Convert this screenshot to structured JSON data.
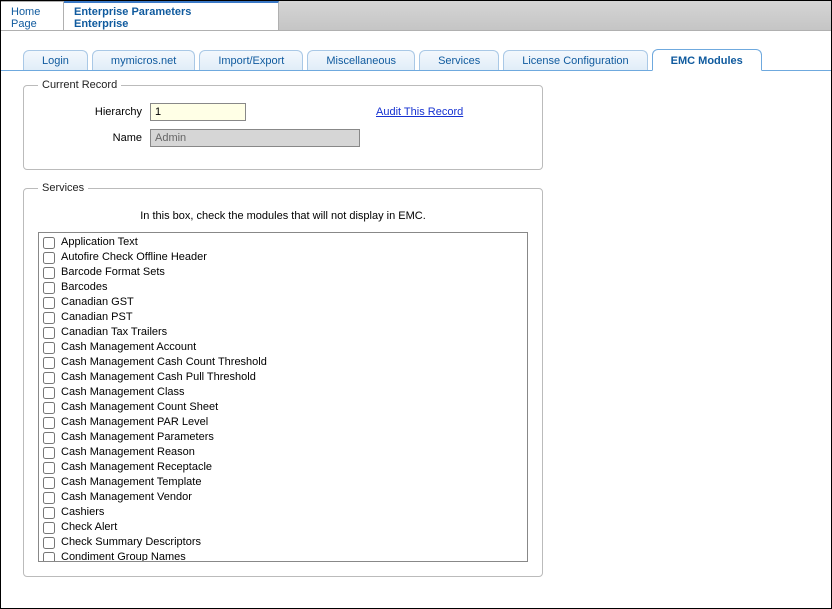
{
  "topbar": {
    "home": {
      "line1": "Home",
      "line2": "Page"
    },
    "enterprise": {
      "line1": "Enterprise Parameters",
      "line2": "Enterprise"
    }
  },
  "tabs": [
    {
      "label": "Login"
    },
    {
      "label": "mymicros.net"
    },
    {
      "label": "Import/Export"
    },
    {
      "label": "Miscellaneous"
    },
    {
      "label": "Services"
    },
    {
      "label": "License Configuration"
    },
    {
      "label": "EMC Modules"
    }
  ],
  "current_record": {
    "legend": "Current Record",
    "hierarchy_label": "Hierarchy",
    "hierarchy_value": "1",
    "name_label": "Name",
    "name_value": "Admin",
    "audit_link": "Audit This Record"
  },
  "services": {
    "legend": "Services",
    "instruction": "In this box, check the modules that will not display in EMC.",
    "modules": [
      {
        "label": "Application Text",
        "checked": false
      },
      {
        "label": "Autofire Check Offline Header",
        "checked": false
      },
      {
        "label": "Barcode Format Sets",
        "checked": false
      },
      {
        "label": "Barcodes",
        "checked": false
      },
      {
        "label": "Canadian GST",
        "checked": false
      },
      {
        "label": "Canadian PST",
        "checked": false
      },
      {
        "label": "Canadian Tax Trailers",
        "checked": false
      },
      {
        "label": "Cash Management Account",
        "checked": false
      },
      {
        "label": "Cash Management Cash Count Threshold",
        "checked": false
      },
      {
        "label": "Cash Management Cash Pull Threshold",
        "checked": false
      },
      {
        "label": "Cash Management Class",
        "checked": false
      },
      {
        "label": "Cash Management Count Sheet",
        "checked": false
      },
      {
        "label": "Cash Management PAR Level",
        "checked": false
      },
      {
        "label": "Cash Management Parameters",
        "checked": false
      },
      {
        "label": "Cash Management Reason",
        "checked": false
      },
      {
        "label": "Cash Management Receptacle",
        "checked": false
      },
      {
        "label": "Cash Management Template",
        "checked": false
      },
      {
        "label": "Cash Management Vendor",
        "checked": false
      },
      {
        "label": "Cashiers",
        "checked": false
      },
      {
        "label": "Check Alert",
        "checked": false
      },
      {
        "label": "Check Summary Descriptors",
        "checked": false
      },
      {
        "label": "Condiment Group Names",
        "checked": false
      }
    ]
  }
}
